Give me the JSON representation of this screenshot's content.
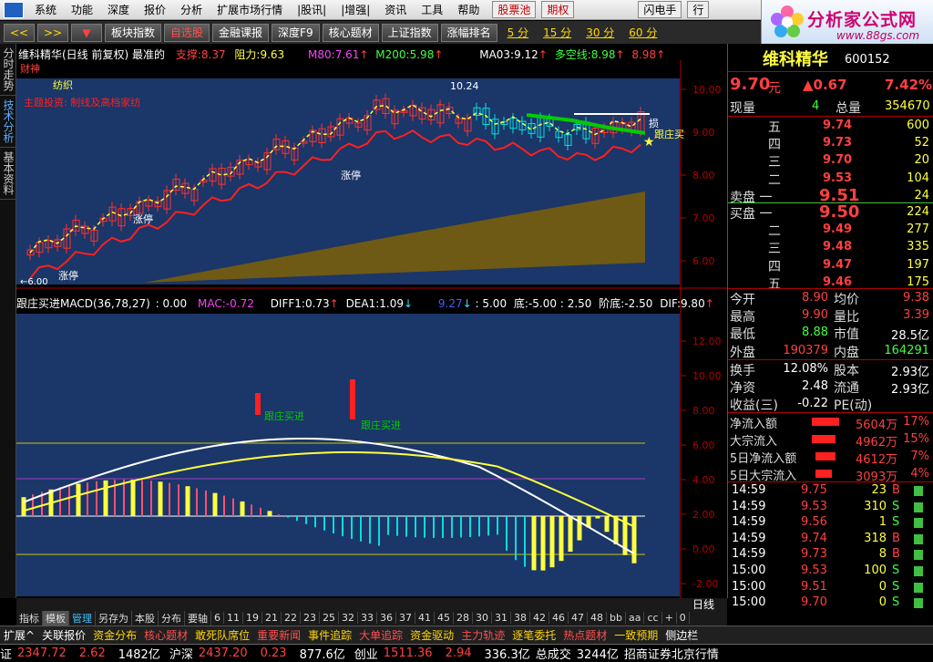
{
  "menu": {
    "items": [
      "系统",
      "功能",
      "深度",
      "报价",
      "分析",
      "扩展市场行情",
      "|股讯|",
      "|增强|",
      "资讯",
      "工具",
      "帮助"
    ],
    "red_items": [
      "股票池",
      "期权"
    ],
    "flash_btn": "闪电手",
    "trade_btn": "行"
  },
  "brand": {
    "title": "分析家公式网",
    "url": "www.88gs.com"
  },
  "toolbar": {
    "nav_left": "<<",
    "nav_right": ">>",
    "nav_down": "▼",
    "buttons": [
      "板块指数",
      "自选股",
      "金融课报",
      "深度F9",
      "核心题材",
      "上证指数",
      "涨幅排名"
    ],
    "periods": [
      "5 分",
      "15 分",
      "30 分",
      "60 分"
    ]
  },
  "leftbar": [
    "分时走势",
    "技术分析",
    "基本资料"
  ],
  "main_header": {
    "name": "维科精华(日线 前复权) 最准的",
    "support_label": "支撑:",
    "support": "8.37",
    "resist_label": "阻力:",
    "resist": "9.63",
    "m80_label": "M80:",
    "m80": "7.61",
    "m200_label": "M200:",
    "m200": "5.98",
    "ma03_label": "MA03:",
    "ma03": "9.12",
    "dk_label": "多空线:",
    "dk": "8.98",
    "last": "8.98"
  },
  "annotations": {
    "caishen": "财神",
    "fangzhi": "纺织",
    "theme": "主题投资: 制线及高档家纺",
    "high": "10.24",
    "zhangting": "涨停",
    "dunchu": "逃",
    "genzhuang": "跟庄买",
    "low_mark": "6.00",
    "sun": "损"
  },
  "main_axis": [
    "10.00",
    "9.00",
    "8.00",
    "7.00",
    "6.00"
  ],
  "macd_header": {
    "title": "跟庄买进MACD(36,78,27)",
    "v0": ": 0.00",
    "mac_label": "MAC:",
    "mac": "-0.72",
    "diff_label": "DIFF1:",
    "diff": "0.73",
    "dea_label": "DEA1:",
    "dea": "1.09",
    "v1": "9.27",
    "v2": ": 5.00",
    "di_label": "底:",
    "di": "-5.00",
    "v3": ": 2.50",
    "jd_label": "阶底:",
    "jd": "-2.50",
    "dif_label": "DIF:",
    "dif": "9.80"
  },
  "macd_labels": {
    "buy1": "跟庄买进",
    "buy2": "跟庄买进"
  },
  "macd_axis": [
    "12.00",
    "10.00",
    "8.00",
    "6.00",
    "4.00",
    "2.00",
    "0.00",
    "-2.00"
  ],
  "xaxis": {
    "year": "2014年",
    "m8": "8",
    "m9": "9",
    "day_label": "日线"
  },
  "bottom_tabs": [
    "指标",
    "模板",
    "管理",
    "另存为",
    "本股",
    "分布",
    "要轴",
    "6",
    "11",
    "19",
    "21",
    "22",
    "23",
    "25",
    "32",
    "33",
    "36",
    "37",
    "41",
    "45",
    "28",
    "30",
    "31",
    "38",
    "42",
    "46",
    "47",
    "48",
    "bb",
    "aa",
    "cc",
    "+",
    "0"
  ],
  "quote": {
    "name": "维科精华",
    "code": "600152",
    "price": "9.70",
    "unit": "元",
    "change": "▲0.67",
    "pct": "7.42%",
    "xianliang_label": "现量",
    "xianliang": "4",
    "zongliang_label": "总量",
    "zongliang": "354670",
    "sell": [
      {
        "label": "五",
        "price": "9.74",
        "vol": "600"
      },
      {
        "label": "四",
        "price": "9.73",
        "vol": "52"
      },
      {
        "label": "三",
        "price": "9.70",
        "vol": "20"
      },
      {
        "label": "二",
        "price": "9.53",
        "vol": "104"
      },
      {
        "label": "卖盘 一",
        "price": "9.51",
        "vol": "24"
      }
    ],
    "buy": [
      {
        "label": "买盘 一",
        "price": "9.50",
        "vol": "224"
      },
      {
        "label": "二",
        "price": "9.49",
        "vol": "277"
      },
      {
        "label": "三",
        "price": "9.48",
        "vol": "335"
      },
      {
        "label": "四",
        "price": "9.47",
        "vol": "197"
      },
      {
        "label": "五",
        "price": "9.46",
        "vol": "175"
      }
    ],
    "stats": [
      {
        "l1": "今开",
        "v1": "8.90",
        "l2": "均价",
        "v2": "9.38"
      },
      {
        "l1": "最高",
        "v1": "9.90",
        "l2": "量比",
        "v2": "3.39"
      },
      {
        "l1": "最低",
        "v1": "8.88",
        "l2": "市值",
        "v2": "28.5亿"
      },
      {
        "l1": "外盘",
        "v1": "190379",
        "l2": "内盘",
        "v2": "164291"
      }
    ],
    "stats2": [
      {
        "l1": "换手",
        "v1": "12.08%",
        "l2": "股本",
        "v2": "2.93亿"
      },
      {
        "l1": "净资",
        "v1": "2.48",
        "l2": "流通",
        "v2": "2.93亿"
      },
      {
        "l1": "收益(三)",
        "v1": "-0.22",
        "l2": "PE(动)",
        "v2": ""
      }
    ],
    "flows": [
      {
        "label": "净流入额",
        "val": "5604万",
        "pct": "17%"
      },
      {
        "label": "大宗流入",
        "val": "4962万",
        "pct": "15%"
      },
      {
        "label": "5日净流入额",
        "val": "4612万",
        "pct": "7%"
      },
      {
        "label": "5日大宗流入",
        "val": "3093万",
        "pct": "4%"
      }
    ],
    "ticks": [
      {
        "t": "14:59",
        "p": "9.75",
        "v": "23",
        "s": "B"
      },
      {
        "t": "14:59",
        "p": "9.53",
        "v": "310",
        "s": "S"
      },
      {
        "t": "14:59",
        "p": "9.56",
        "v": "1",
        "s": "S"
      },
      {
        "t": "14:59",
        "p": "9.74",
        "v": "318",
        "s": "B"
      },
      {
        "t": "14:59",
        "p": "9.73",
        "v": "8",
        "s": "B"
      },
      {
        "t": "15:00",
        "p": "9.53",
        "v": "100",
        "s": "S"
      },
      {
        "t": "15:00",
        "p": "9.51",
        "v": "0",
        "s": "S"
      },
      {
        "t": "15:00",
        "p": "9.70",
        "v": "0",
        "s": "S"
      }
    ],
    "rp_tabs": [
      "笔",
      "价",
      "细",
      "日",
      "势",
      "联",
      "值",
      "筹"
    ]
  },
  "funcbar": [
    "扩展^",
    "关联报价",
    "资金分布",
    "核心题材",
    "敢死队席位",
    "重要新闻",
    "事件追踪",
    "大单追踪",
    "资金驱动",
    "主力轨迹",
    "逐笔委托",
    "热点题材",
    "一致预期",
    "侧边栏"
  ],
  "status": {
    "sh_label": "证",
    "sh": "2347.72",
    "sh_chg": "2.62",
    "sh_amt": "1482亿",
    "sz_label": "沪深",
    "sz": "2437.20",
    "sz_chg": "0.23",
    "sz_amt": "877.6亿",
    "cy_label": "创业",
    "cy": "1511.36",
    "cy_chg": "2.94",
    "cy_amt": "336.3亿",
    "total_label": "总成交",
    "total": "3244亿",
    "broker": "招商证券北京行情"
  },
  "colors": {
    "up": "#ff3030",
    "down": "#00e0e0",
    "yellow": "#ffff40",
    "panel_bg": "#1b3668",
    "green": "#00cc00",
    "gold": "#6e5a14"
  }
}
